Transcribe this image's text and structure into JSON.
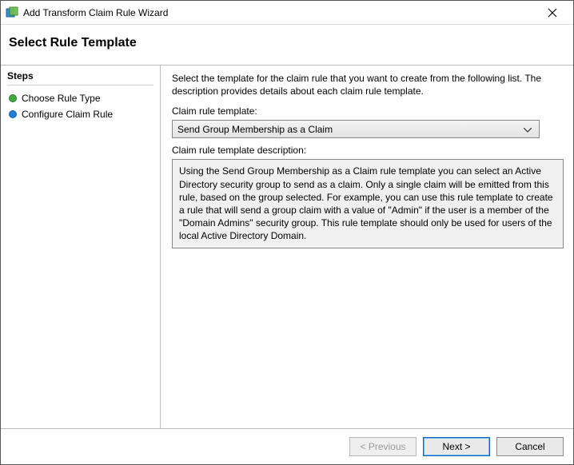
{
  "window": {
    "title": "Add Transform Claim Rule Wizard"
  },
  "header": {
    "title": "Select Rule Template"
  },
  "sidebar": {
    "steps_label": "Steps",
    "items": [
      {
        "label": "Choose Rule Type",
        "state": "done"
      },
      {
        "label": "Configure Claim Rule",
        "state": "current"
      }
    ]
  },
  "main": {
    "instruction": "Select the template for the claim rule that you want to create from the following list. The description provides details about each claim rule template.",
    "template_label": "Claim rule template:",
    "template_selected": "Send Group Membership as a Claim",
    "description_label": "Claim rule template description:",
    "description_text": "Using the Send Group Membership as a Claim rule template you can select an Active Directory security group to send as a claim. Only a single claim will be emitted from this rule, based on the group selected. For example, you can use this rule template to create a rule that will send a group claim with a value of \"Admin\" if the user is a member of the \"Domain Admins\" security group.  This rule template should only be used for users of the local Active Directory Domain."
  },
  "footer": {
    "previous": "< Previous",
    "next": "Next >",
    "cancel": "Cancel"
  }
}
